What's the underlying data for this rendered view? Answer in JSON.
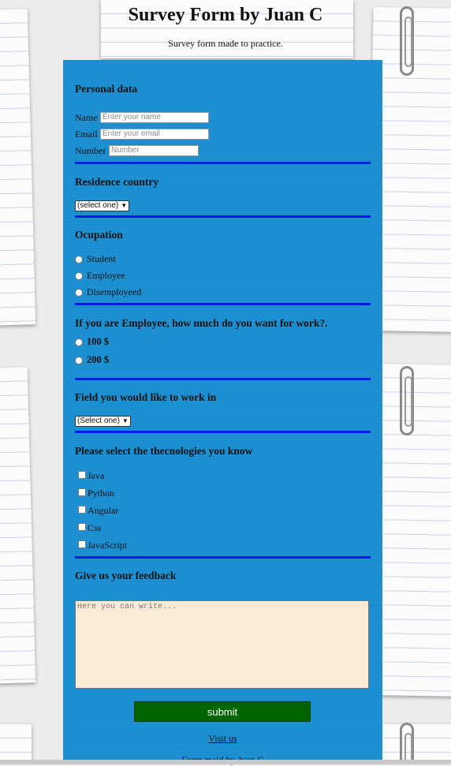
{
  "header": {
    "title": "Survey Form by Juan C",
    "subtitle": "Survey form made to practice."
  },
  "personal": {
    "heading": "Personal data",
    "name_label": "Name",
    "name_placeholder": "Enter your name",
    "email_label": "Email",
    "email_placeholder": "Enter your email",
    "number_label": "Number",
    "number_placeholder": "Number"
  },
  "residence": {
    "heading": "Residence country",
    "selected": "(select one)"
  },
  "occupation": {
    "heading": "Ocupation",
    "options": [
      "Student",
      "Employee",
      "Disemployeed"
    ]
  },
  "salary": {
    "heading": "If you are Employee, how much do you want for work?.",
    "options": [
      "100 $",
      "200 $"
    ]
  },
  "field": {
    "heading": "Field you would like to work in",
    "selected": "(Select one)"
  },
  "tech": {
    "heading": "Please select the thecnologies you know",
    "options": [
      "Java",
      "Python",
      "Angular",
      "Css",
      "JavaScript"
    ]
  },
  "feedback": {
    "heading": "Give us your feedback",
    "placeholder": "Here you can write..."
  },
  "submit_label": "submit",
  "visit_label": "Visit us",
  "footer_text": "Form maid by Juan C",
  "colors": {
    "form_bg": "#1a8ed0",
    "rule": "#0019e6",
    "submit_bg": "#006400",
    "textarea_bg": "#faebd7"
  }
}
